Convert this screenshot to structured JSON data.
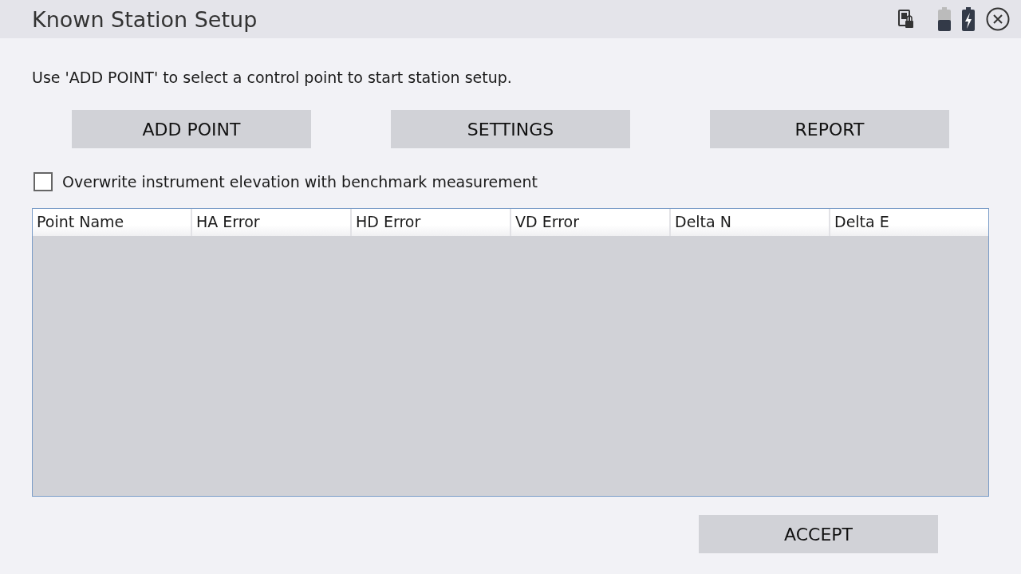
{
  "window": {
    "title": "Known Station Setup"
  },
  "instruction": "Use 'ADD POINT' to select a control point to start station setup.",
  "buttons": [
    "ADD POINT",
    "SETTINGS",
    "REPORT"
  ],
  "overwrite_option": {
    "label": "Overwrite instrument elevation with benchmark measurement",
    "checked": false
  },
  "table": {
    "columns": [
      "Point Name",
      "HA Error",
      "HD Error",
      "VD Error",
      "Delta N",
      "Delta E"
    ]
  },
  "accept_button": "ACCEPT"
}
